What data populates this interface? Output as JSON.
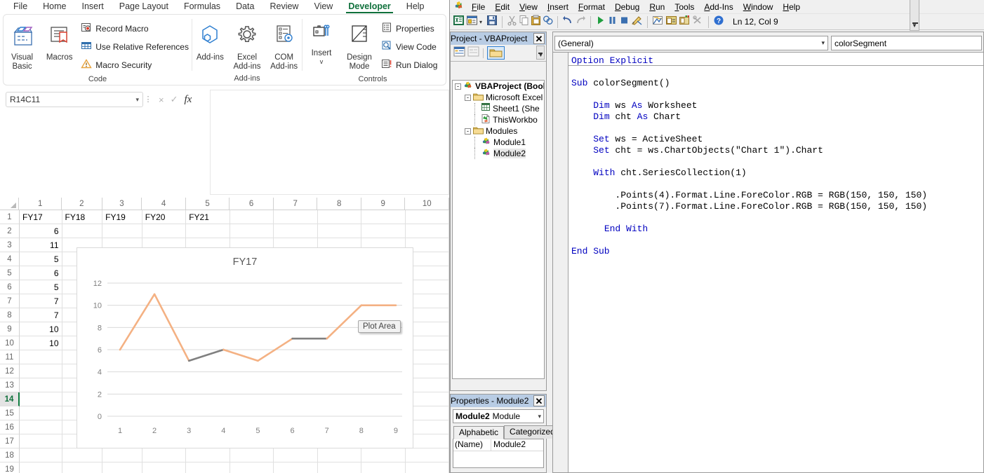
{
  "excel": {
    "ribbon_tabs": [
      {
        "label": "File",
        "active": false
      },
      {
        "label": "Home",
        "active": false
      },
      {
        "label": "Insert",
        "active": false
      },
      {
        "label": "Page Layout",
        "active": false
      },
      {
        "label": "Formulas",
        "active": false
      },
      {
        "label": "Data",
        "active": false
      },
      {
        "label": "Review",
        "active": false
      },
      {
        "label": "View",
        "active": false
      },
      {
        "label": "Developer",
        "active": true
      },
      {
        "label": "Help",
        "active": false
      }
    ],
    "ribbon_groups": [
      {
        "name": "Code",
        "label": "Code",
        "big": [
          {
            "label": "Visual Basic",
            "icon": "visual-basic-icon"
          },
          {
            "label": "Macros",
            "icon": "macros-icon"
          }
        ],
        "small": [
          {
            "label": "Record Macro",
            "icon": "record-macro-icon"
          },
          {
            "label": "Use Relative References",
            "icon": "relative-references-icon"
          },
          {
            "label": "Macro Security",
            "icon": "macro-security-icon"
          }
        ]
      },
      {
        "name": "Add-ins",
        "label": "Add-ins",
        "big": [
          {
            "label": "Add-ins",
            "icon": "add-ins-icon"
          },
          {
            "label": "Excel Add-ins",
            "icon": "excel-add-ins-icon"
          },
          {
            "label": "COM Add-ins",
            "icon": "com-add-ins-icon"
          }
        ],
        "small": []
      },
      {
        "name": "Controls",
        "label": "Controls",
        "big": [
          {
            "label": "Insert",
            "icon": "insert-control-icon",
            "caret": "v"
          },
          {
            "label": "Design Mode",
            "icon": "design-mode-icon"
          }
        ],
        "small": [
          {
            "label": "Properties",
            "icon": "properties-icon"
          },
          {
            "label": "View Code",
            "icon": "view-code-icon"
          },
          {
            "label": "Run Dialog",
            "icon": "run-dialog-icon"
          }
        ]
      }
    ],
    "namebox": {
      "value": "R14C11",
      "placeholder": "Name Box"
    },
    "formula_bar": {
      "value": "",
      "placeholder": ""
    },
    "formula_buttons": [
      {
        "name": "cancel-icon",
        "glyph": "×"
      },
      {
        "name": "enter-icon",
        "glyph": "✓"
      },
      {
        "name": "insert-function-icon",
        "glyph": "fx"
      }
    ],
    "grid": {
      "column_headers": [
        "1",
        "2",
        "3",
        "4",
        "5",
        "6",
        "7",
        "8",
        "9",
        "10"
      ],
      "row_headers": [
        "1",
        "2",
        "3",
        "4",
        "5",
        "6",
        "7",
        "8",
        "9",
        "10",
        "11",
        "12",
        "13",
        "14",
        "15",
        "16",
        "17",
        "18",
        "19"
      ],
      "selected_row": "14",
      "rows": [
        [
          "FY17",
          "FY18",
          "FY19",
          "FY20",
          "FY21",
          "",
          "",
          "",
          "",
          ""
        ],
        [
          "6",
          "",
          "",
          "",
          "",
          "",
          "",
          "",
          "",
          ""
        ],
        [
          "11",
          "",
          "",
          "",
          "",
          "",
          "",
          "",
          "",
          ""
        ],
        [
          "5",
          "",
          "",
          "",
          "",
          "",
          "",
          "",
          "",
          ""
        ],
        [
          "6",
          "",
          "",
          "",
          "",
          "",
          "",
          "",
          "",
          ""
        ],
        [
          "5",
          "",
          "",
          "",
          "",
          "",
          "",
          "",
          "",
          ""
        ],
        [
          "7",
          "",
          "",
          "",
          "",
          "",
          "",
          "",
          "",
          ""
        ],
        [
          "7",
          "",
          "",
          "",
          "",
          "",
          "",
          "",
          "",
          ""
        ],
        [
          "10",
          "",
          "",
          "",
          "",
          "",
          "",
          "",
          "",
          ""
        ],
        [
          "10",
          "",
          "",
          "",
          "",
          "",
          "",
          "",
          "",
          ""
        ],
        [
          "",
          "",
          "",
          "",
          "",
          "",
          "",
          "",
          "",
          ""
        ],
        [
          "",
          "",
          "",
          "",
          "",
          "",
          "",
          "",
          "",
          ""
        ],
        [
          "",
          "",
          "",
          "",
          "",
          "",
          "",
          "",
          "",
          ""
        ],
        [
          "",
          "",
          "",
          "",
          "",
          "",
          "",
          "",
          "",
          ""
        ],
        [
          "",
          "",
          "",
          "",
          "",
          "",
          "",
          "",
          "",
          ""
        ],
        [
          "",
          "",
          "",
          "",
          "",
          "",
          "",
          "",
          "",
          ""
        ],
        [
          "",
          "",
          "",
          "",
          "",
          "",
          "",
          "",
          "",
          ""
        ],
        [
          "",
          "",
          "",
          "",
          "",
          "",
          "",
          "",
          "",
          ""
        ],
        [
          "",
          "",
          "",
          "",
          "",
          "",
          "",
          "",
          "",
          ""
        ]
      ]
    },
    "chart_tooltip": "Plot Area"
  },
  "chart_data": {
    "type": "line",
    "title": "FY17",
    "xlabel": "",
    "ylabel": "",
    "x": [
      1,
      2,
      3,
      4,
      5,
      6,
      7,
      8,
      9
    ],
    "categories": [
      "1",
      "2",
      "3",
      "4",
      "5",
      "6",
      "7",
      "8",
      "9"
    ],
    "values": [
      6,
      11,
      5,
      6,
      5,
      7,
      7,
      10,
      10
    ],
    "ylim": [
      0,
      12
    ],
    "yticks": [
      0,
      2,
      4,
      6,
      8,
      10,
      12
    ],
    "grid": true,
    "legend": false,
    "series": [
      {
        "name": "FY17",
        "values": [
          6,
          11,
          5,
          6,
          5,
          7,
          7,
          10,
          10
        ]
      }
    ],
    "line_color": "#f4b183",
    "highlight_color": "#808080",
    "highlighted_segments": [
      {
        "from_point": 3,
        "to_point": 4,
        "color": "#808080"
      },
      {
        "from_point": 6,
        "to_point": 7,
        "color": "#808080"
      }
    ]
  },
  "vba": {
    "menu": [
      "File",
      "Edit",
      "View",
      "Insert",
      "Format",
      "Debug",
      "Run",
      "Tools",
      "Add-Ins",
      "Window",
      "Help"
    ],
    "toolbar_icons": [
      "view-excel-icon",
      "insert-userform-icon",
      "insert-dropdown-icon",
      "save-icon",
      "cut-icon",
      "copy-icon",
      "paste-icon",
      "find-icon",
      "undo-icon",
      "redo-icon",
      "run-icon",
      "break-icon",
      "reset-icon",
      "design-mode-icon",
      "project-explorer-icon",
      "properties-window-icon",
      "object-browser-icon",
      "toolbox-icon",
      "help-icon"
    ],
    "status": "Ln 12, Col 9",
    "project_explorer": {
      "title": "Project - VBAProject",
      "close_label": "✕",
      "toolbar_icons": [
        "view-code-icon",
        "view-object-icon",
        "toggle-folders-icon"
      ],
      "tree": [
        {
          "depth": 0,
          "expander": "-",
          "icon": "vbaproject-icon",
          "label": "VBAProject (Bool",
          "bold": true,
          "selected": false
        },
        {
          "depth": 1,
          "expander": "-",
          "icon": "folder-icon",
          "label": "Microsoft Excel",
          "bold": false,
          "selected": false
        },
        {
          "depth": 2,
          "expander": "",
          "icon": "sheet-icon",
          "label": "Sheet1 (She",
          "bold": false,
          "selected": false
        },
        {
          "depth": 2,
          "expander": "",
          "icon": "workbook-icon",
          "label": "ThisWorkbo",
          "bold": false,
          "selected": false
        },
        {
          "depth": 1,
          "expander": "-",
          "icon": "folder-icon",
          "label": "Modules",
          "bold": false,
          "selected": false
        },
        {
          "depth": 2,
          "expander": "",
          "icon": "module-icon",
          "label": "Module1",
          "bold": false,
          "selected": false
        },
        {
          "depth": 2,
          "expander": "",
          "icon": "module-icon",
          "label": "Module2",
          "bold": false,
          "selected": true
        }
      ]
    },
    "properties_window": {
      "title": "Properties - Module2",
      "close_label": "✕",
      "object_name": "Module2",
      "object_type": "Module",
      "tabs": [
        {
          "label": "Alphabetic",
          "active": true
        },
        {
          "label": "Categorized",
          "active": false
        }
      ],
      "rows": [
        {
          "key": "(Name)",
          "value": "Module2"
        }
      ]
    },
    "code_window": {
      "object_combo": "(General)",
      "proc_combo": "colorSegment",
      "code_lines": [
        {
          "text": "Option Explicit",
          "parts": [
            {
              "t": "Option Explicit",
              "c": "kw"
            }
          ]
        },
        {
          "text": "",
          "parts": []
        },
        {
          "text": "Sub colorSegment()",
          "parts": [
            {
              "t": "Sub",
              "c": "kw"
            },
            {
              "t": " colorSegment()",
              "c": ""
            }
          ]
        },
        {
          "text": "",
          "parts": []
        },
        {
          "text": "    Dim ws As Worksheet",
          "parts": [
            {
              "t": "    ",
              "c": ""
            },
            {
              "t": "Dim",
              "c": "kw"
            },
            {
              "t": " ws ",
              "c": ""
            },
            {
              "t": "As",
              "c": "kw"
            },
            {
              "t": " Worksheet",
              "c": ""
            }
          ]
        },
        {
          "text": "    Dim cht As Chart",
          "parts": [
            {
              "t": "    ",
              "c": ""
            },
            {
              "t": "Dim",
              "c": "kw"
            },
            {
              "t": " cht ",
              "c": ""
            },
            {
              "t": "As",
              "c": "kw"
            },
            {
              "t": " Chart",
              "c": ""
            }
          ]
        },
        {
          "text": "",
          "parts": []
        },
        {
          "text": "    Set ws = ActiveSheet",
          "parts": [
            {
              "t": "    ",
              "c": ""
            },
            {
              "t": "Set",
              "c": "kw"
            },
            {
              "t": " ws = ActiveSheet",
              "c": ""
            }
          ]
        },
        {
          "text": "    Set cht = ws.ChartObjects(\"Chart 1\").Chart",
          "parts": [
            {
              "t": "    ",
              "c": ""
            },
            {
              "t": "Set",
              "c": "kw"
            },
            {
              "t": " cht = ws.ChartObjects(\"Chart 1\").Chart",
              "c": ""
            }
          ]
        },
        {
          "text": "",
          "parts": []
        },
        {
          "text": "    With cht.SeriesCollection(1)",
          "parts": [
            {
              "t": "    ",
              "c": ""
            },
            {
              "t": "With",
              "c": "kw"
            },
            {
              "t": " cht.SeriesCollection(1)",
              "c": ""
            }
          ]
        },
        {
          "text": "",
          "parts": []
        },
        {
          "text": "        .Points(4).Format.Line.ForeColor.RGB = RGB(150, 150, 150)",
          "parts": [
            {
              "t": "        .Points(4).Format.Line.ForeColor.RGB = RGB(150, 150, 150)",
              "c": ""
            }
          ]
        },
        {
          "text": "        .Points(7).Format.Line.ForeColor.RGB = RGB(150, 150, 150)",
          "parts": [
            {
              "t": "        .Points(7).Format.Line.ForeColor.RGB = RGB(150, 150, 150)",
              "c": ""
            }
          ]
        },
        {
          "text": "",
          "parts": []
        },
        {
          "text": "      End With",
          "parts": [
            {
              "t": "      ",
              "c": ""
            },
            {
              "t": "End With",
              "c": "kw"
            }
          ]
        },
        {
          "text": "",
          "parts": []
        },
        {
          "text": "End Sub",
          "parts": [
            {
              "t": "End Sub",
              "c": "kw"
            }
          ]
        }
      ]
    }
  }
}
